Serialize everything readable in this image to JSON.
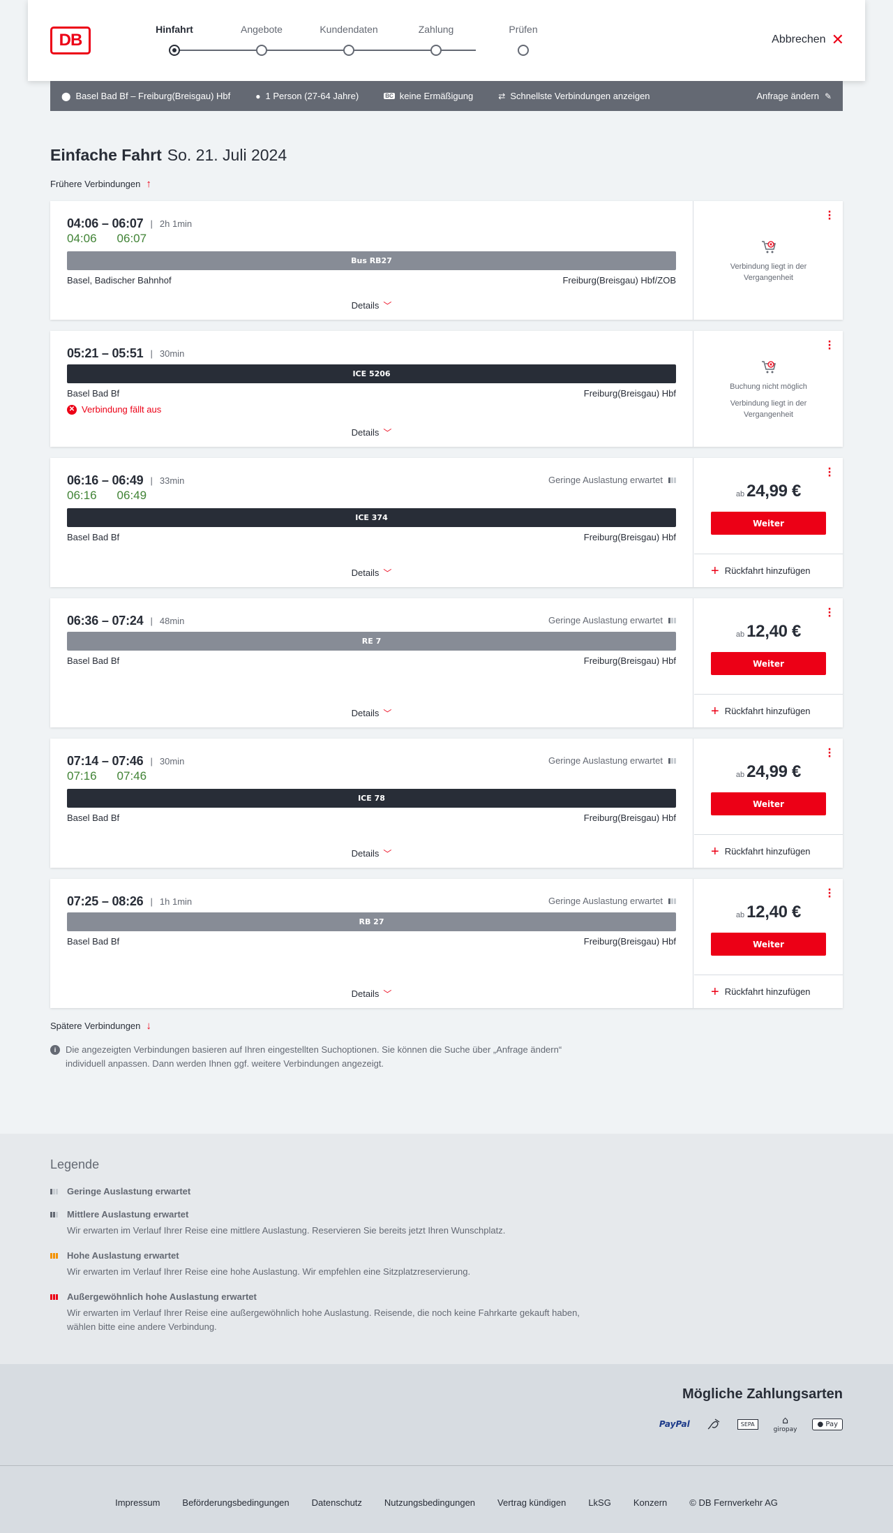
{
  "header": {
    "logo_text": "DB",
    "steps": [
      "Hinfahrt",
      "Angebote",
      "Kundendaten",
      "Zahlung",
      "Prüfen"
    ],
    "active_step": 0,
    "cancel_label": "Abbrechen"
  },
  "search": {
    "route": "Basel Bad Bf – Freiburg(Breisgau) Hbf",
    "passengers": "1 Person (27-64 Jahre)",
    "discount_badge": "BC",
    "discount": "keine Ermäßigung",
    "option": "Schnellste Verbindungen anzeigen",
    "change_label": "Anfrage ändern"
  },
  "page": {
    "title_bold": "Einfache Fahrt",
    "title_date": "So. 21. Juli 2024",
    "earlier_label": "Frühere Verbindungen",
    "later_label": "Spätere Verbindungen",
    "info_text": "Die angezeigten Verbindungen basieren auf Ihren eingestellten Suchoptionen. Sie können die Suche über „Anfrage ändern“ individuell anpassen. Dann werden Ihnen ggf. weitere Verbindungen angezeigt."
  },
  "connections": [
    {
      "times": "04:06 – 06:07",
      "duration": "2h 1min",
      "rt_dep": "04:06",
      "rt_arr": "06:07",
      "train": "Bus RB27",
      "train_style": "grey",
      "from": "Basel, Badischer Bahnhof",
      "to": "Freiburg(Breisgau) Hbf/ZOB",
      "load": "",
      "cancelled": "",
      "details_label": "Details",
      "booking_note": "",
      "past_note": "Verbindung liegt in der Vergangenheit",
      "price_prefix": "",
      "price": "",
      "button": "",
      "return_label": ""
    },
    {
      "times": "05:21 – 05:51",
      "duration": "30min",
      "rt_dep": "",
      "rt_arr": "",
      "train": "ICE 5206",
      "train_style": "dark",
      "from": "Basel Bad Bf",
      "to": "Freiburg(Breisgau) Hbf",
      "load": "",
      "cancelled": "Verbindung fällt aus",
      "details_label": "Details",
      "booking_note": "Buchung nicht möglich",
      "past_note": "Verbindung liegt in der Vergangenheit",
      "price_prefix": "",
      "price": "",
      "button": "",
      "return_label": ""
    },
    {
      "times": "06:16 – 06:49",
      "duration": "33min",
      "rt_dep": "06:16",
      "rt_arr": "06:49",
      "train": "ICE 374",
      "train_style": "dark",
      "from": "Basel Bad Bf",
      "to": "Freiburg(Breisgau) Hbf",
      "load": "Geringe Auslastung erwartet",
      "cancelled": "",
      "details_label": "Details",
      "booking_note": "",
      "past_note": "",
      "price_prefix": "ab",
      "price": "24,99 €",
      "button": "Weiter",
      "return_label": "Rückfahrt hinzufügen"
    },
    {
      "times": "06:36 – 07:24",
      "duration": "48min",
      "rt_dep": "",
      "rt_arr": "",
      "train": "RE 7",
      "train_style": "grey",
      "from": "Basel Bad Bf",
      "to": "Freiburg(Breisgau) Hbf",
      "load": "Geringe Auslastung erwartet",
      "cancelled": "",
      "details_label": "Details",
      "booking_note": "",
      "past_note": "",
      "price_prefix": "ab",
      "price": "12,40 €",
      "button": "Weiter",
      "return_label": "Rückfahrt hinzufügen"
    },
    {
      "times": "07:14 – 07:46",
      "duration": "30min",
      "rt_dep": "07:16",
      "rt_arr": "07:46",
      "train": "ICE 78",
      "train_style": "dark",
      "from": "Basel Bad Bf",
      "to": "Freiburg(Breisgau) Hbf",
      "load": "Geringe Auslastung erwartet",
      "cancelled": "",
      "details_label": "Details",
      "booking_note": "",
      "past_note": "",
      "price_prefix": "ab",
      "price": "24,99 €",
      "button": "Weiter",
      "return_label": "Rückfahrt hinzufügen"
    },
    {
      "times": "07:25 – 08:26",
      "duration": "1h 1min",
      "rt_dep": "",
      "rt_arr": "",
      "train": "RB 27",
      "train_style": "grey",
      "from": "Basel Bad Bf",
      "to": "Freiburg(Breisgau) Hbf",
      "load": "Geringe Auslastung erwartet",
      "cancelled": "",
      "details_label": "Details",
      "booking_note": "",
      "past_note": "",
      "price_prefix": "ab",
      "price": "12,40 €",
      "button": "Weiter",
      "return_label": "Rückfahrt hinzufügen"
    }
  ],
  "legend": {
    "title": "Legende",
    "items": [
      {
        "title": "Geringe Auslastung erwartet",
        "desc": "",
        "color": "#646973",
        "level": 1
      },
      {
        "title": "Mittlere Auslastung erwartet",
        "desc": "Wir erwarten im Verlauf Ihrer Reise eine mittlere Auslastung. Reservieren Sie bereits jetzt Ihren Wunschplatz.",
        "color": "#646973",
        "level": 2
      },
      {
        "title": "Hohe Auslastung erwartet",
        "desc": "Wir erwarten im Verlauf Ihrer Reise eine hohe Auslastung. Wir empfehlen eine Sitzplatzreservierung.",
        "color": "#f39200",
        "level": 3
      },
      {
        "title": "Außergewöhnlich hohe Auslastung erwartet",
        "desc": "Wir erwarten im Verlauf Ihrer Reise eine außergewöhnlich hohe Auslastung. Reisende, die noch keine Fahrkarte gekauft haben, wählen bitte eine andere Verbindung.",
        "color": "#ec0016",
        "level": 4
      }
    ]
  },
  "payment": {
    "title": "Mögliche Zahlungsarten",
    "methods": [
      "PayPal",
      "SEPA",
      "giropay",
      "Pay"
    ]
  },
  "footer": {
    "links": [
      "Impressum",
      "Beförderungsbedingungen",
      "Datenschutz",
      "Nutzungsbedingungen",
      "Vertrag kündigen",
      "LkSG",
      "Konzern",
      "© DB Fernverkehr AG"
    ]
  },
  "colors": {
    "accent": "#ec0016",
    "realtime": "#408335",
    "bar": "#646973"
  }
}
